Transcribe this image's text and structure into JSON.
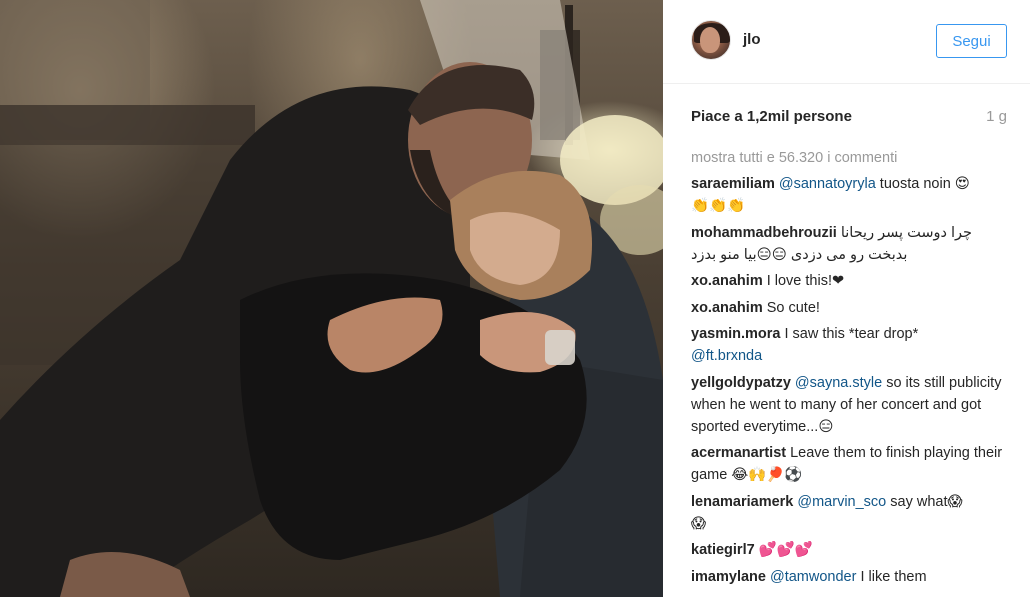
{
  "post": {
    "username": "jlo",
    "follow_label": "Segui",
    "likes_text": "Piace a 1,2mil persone",
    "time_ago": "1 g",
    "view_all_text": "mostra tutti e 56.320 i commenti"
  },
  "comments": [
    {
      "user": "saraemiliam",
      "mention": "@sannatoyryla",
      "text": " tuosta noin 😍",
      "line2": "👏👏👏"
    },
    {
      "user": "mohammadbehrouzii",
      "text": "چرا دوست پسر ریحانا",
      "line2": "بدبخت رو می دزدی 😑😑بیا منو بدزد"
    },
    {
      "user": "xo.anahim",
      "text": "I love this!❤"
    },
    {
      "user": "xo.anahim",
      "text": "So cute!"
    },
    {
      "user": "yasmin.mora",
      "text": "I saw this *tear drop*",
      "mention2": "@ft.brxnda"
    },
    {
      "user": "yellgoldypatzy",
      "mention": "@sayna.style",
      "text": " so its still publicity when he went to many of her concert and got sported everytime...😑"
    },
    {
      "user": "acermanartist",
      "text": "Leave them to finish playing their game 😂🙌🏓⚽"
    },
    {
      "user": "lenamariamerk",
      "mention": "@marvin_sco",
      "text": " say what😱",
      "line2": "😱"
    },
    {
      "user": "katiegirl7",
      "text": "💕💕💕"
    },
    {
      "user": "imamylane",
      "mention": "@tamwonder",
      "text": " I like them"
    }
  ],
  "icons": {
    "avatar": "profile-photo"
  },
  "colors": {
    "accent": "#3897f0",
    "mention": "#125688",
    "muted": "#999999",
    "text": "#262626"
  }
}
